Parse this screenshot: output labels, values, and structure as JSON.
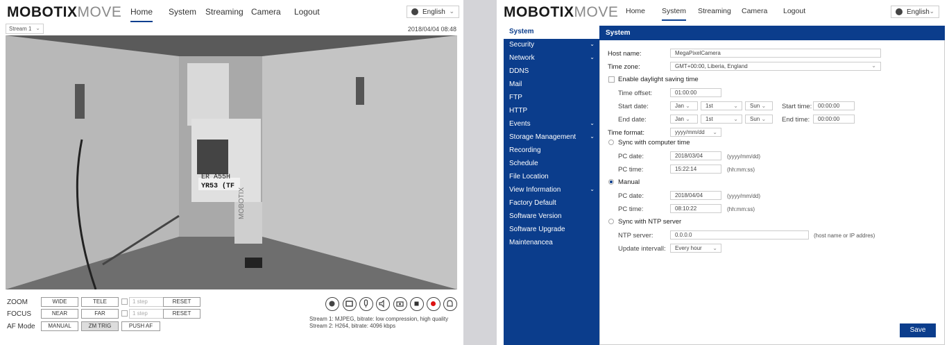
{
  "left": {
    "logo_bold": "MOBOTIX",
    "logo_light": "MOVE",
    "nav": [
      "Home",
      "System",
      "Streaming",
      "Camera",
      "Logout"
    ],
    "language": "English",
    "stream_select": "Stream 1",
    "datetime": "2018/04/04 08:48",
    "video_overlay": [
      "ER A55H",
      "YR53 (TF",
      "MOBOTIX"
    ],
    "controls": {
      "zoom": {
        "label": "ZOOM",
        "btn1": "WIDE",
        "btn2": "TELE",
        "step": "1 step",
        "reset": "RESET"
      },
      "focus": {
        "label": "FOCUS",
        "btn1": "NEAR",
        "btn2": "FAR",
        "step": "1 step",
        "reset": "RESET"
      },
      "af": {
        "label": "AF Mode",
        "btn1": "MANUAL",
        "btn2": "ZM TRIG",
        "btn3": "PUSH AF"
      }
    },
    "icons": [
      "snapshot-icon",
      "fullscreen-icon",
      "microphone-icon",
      "speaker-icon",
      "camera-icon",
      "stop-icon",
      "record-icon",
      "alarm-bell-icon"
    ],
    "stream_info": [
      "Stream 1: MJPEG, bitrate: low compression, high quality",
      "Stream 2: H264, bitrate: 4096 kbps"
    ]
  },
  "right": {
    "logo_bold": "MOBOTIX",
    "logo_light": "MOVE",
    "nav": [
      "Home",
      "System",
      "Streaming",
      "Camera",
      "Logout"
    ],
    "language": "English",
    "sidebar": [
      {
        "label": "System",
        "chevron": false
      },
      {
        "label": "Security",
        "chevron": true
      },
      {
        "label": "Network",
        "chevron": true
      },
      {
        "label": "DDNS",
        "chevron": false
      },
      {
        "label": "Mail",
        "chevron": false
      },
      {
        "label": "FTP",
        "chevron": false
      },
      {
        "label": "HTTP",
        "chevron": false
      },
      {
        "label": "Events",
        "chevron": true
      },
      {
        "label": "Storage Management",
        "chevron": true
      },
      {
        "label": "Recording",
        "chevron": false
      },
      {
        "label": "Schedule",
        "chevron": false
      },
      {
        "label": "File Location",
        "chevron": false
      },
      {
        "label": "View Information",
        "chevron": true
      },
      {
        "label": "Factory Default",
        "chevron": false
      },
      {
        "label": "Software Version",
        "chevron": false
      },
      {
        "label": "Software Upgrade",
        "chevron": false
      },
      {
        "label": "Maintenancea",
        "chevron": false
      }
    ],
    "section_title": "System",
    "form": {
      "host_name_label": "Host name:",
      "host_name": "MegaPixelCamera",
      "time_zone_label": "Time zone:",
      "time_zone": "GMT+00:00, Liberia, England",
      "dst_label": "Enable daylight saving time",
      "time_offset_label": "Time offset:",
      "time_offset": "01:00:00",
      "start_date_label": "Start date:",
      "start_month": "Jan",
      "start_week": "1st",
      "start_day": "Sun",
      "start_time_label": "Start time:",
      "start_time": "00:00:00",
      "end_date_label": "End date:",
      "end_month": "Jan",
      "end_week": "1st",
      "end_day": "Sun",
      "end_time_label": "End time:",
      "end_time": "00:00:00",
      "time_format_label": "Time format:",
      "time_format": "yyyy/mm/dd",
      "sync_pc_label": "Sync with computer time",
      "pc_date_label": "PC date:",
      "pc_date": "2018/03/04",
      "date_hint": "(yyyy/mm/dd)",
      "pc_time_label": "PC time:",
      "pc_time": "15:22:14",
      "time_hint": "(hh:mm:ss)",
      "manual_label": "Manual",
      "manual_date_label": "PC date:",
      "manual_date": "2018/04/04",
      "manual_date_hint": "(yyyy/mm/dd)",
      "manual_time_label": "PC time:",
      "manual_time": "08:10:22",
      "manual_time_hint": "(hh:mm:ss)",
      "ntp_label": "Sync with NTP server",
      "ntp_server_label": "NTP server:",
      "ntp_server": "0.0.0.0",
      "ntp_hint": "(host name or IP addres)",
      "update_interval_label": "Update intervall:",
      "update_interval": "Every hour"
    },
    "save_label": "Save"
  },
  "colors": {
    "accent": "#0b3d8c"
  }
}
